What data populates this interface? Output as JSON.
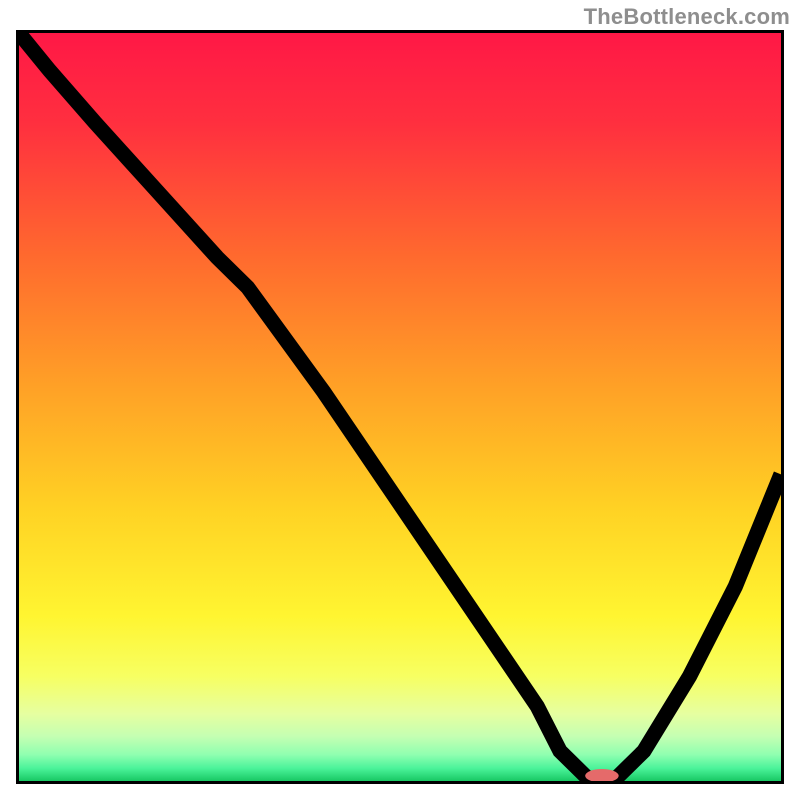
{
  "watermark": "TheBottleneck.com",
  "chart_data": {
    "type": "line",
    "title": "",
    "xlabel": "",
    "ylabel": "",
    "xlim": [
      0,
      100
    ],
    "ylim": [
      0,
      100
    ],
    "grid": false,
    "legend": false,
    "series": [
      {
        "name": "curve",
        "x": [
          0,
          4,
          10,
          18,
          26,
          30,
          40,
          50,
          60,
          68,
          71,
          75,
          78,
          82,
          88,
          94,
          100
        ],
        "values": [
          100,
          95,
          88,
          79,
          70,
          66,
          52,
          37,
          22,
          10,
          4,
          0,
          0,
          4,
          14,
          26,
          41
        ]
      }
    ],
    "marker": {
      "x": 76.5,
      "y": 0,
      "rx": 2.2,
      "ry": 0.9,
      "color": "#e56a6a"
    },
    "gradient_stops": [
      {
        "pct": 0,
        "color": "#ff1846"
      },
      {
        "pct": 12,
        "color": "#ff2f3f"
      },
      {
        "pct": 30,
        "color": "#ff6a2e"
      },
      {
        "pct": 48,
        "color": "#ffa326"
      },
      {
        "pct": 64,
        "color": "#ffd324"
      },
      {
        "pct": 78,
        "color": "#fff531"
      },
      {
        "pct": 86,
        "color": "#f7ff62"
      },
      {
        "pct": 91,
        "color": "#e6ffa0"
      },
      {
        "pct": 94,
        "color": "#c5ffb2"
      },
      {
        "pct": 96.5,
        "color": "#8fffb0"
      },
      {
        "pct": 98.3,
        "color": "#4bf39a"
      },
      {
        "pct": 100,
        "color": "#18c864"
      }
    ]
  }
}
